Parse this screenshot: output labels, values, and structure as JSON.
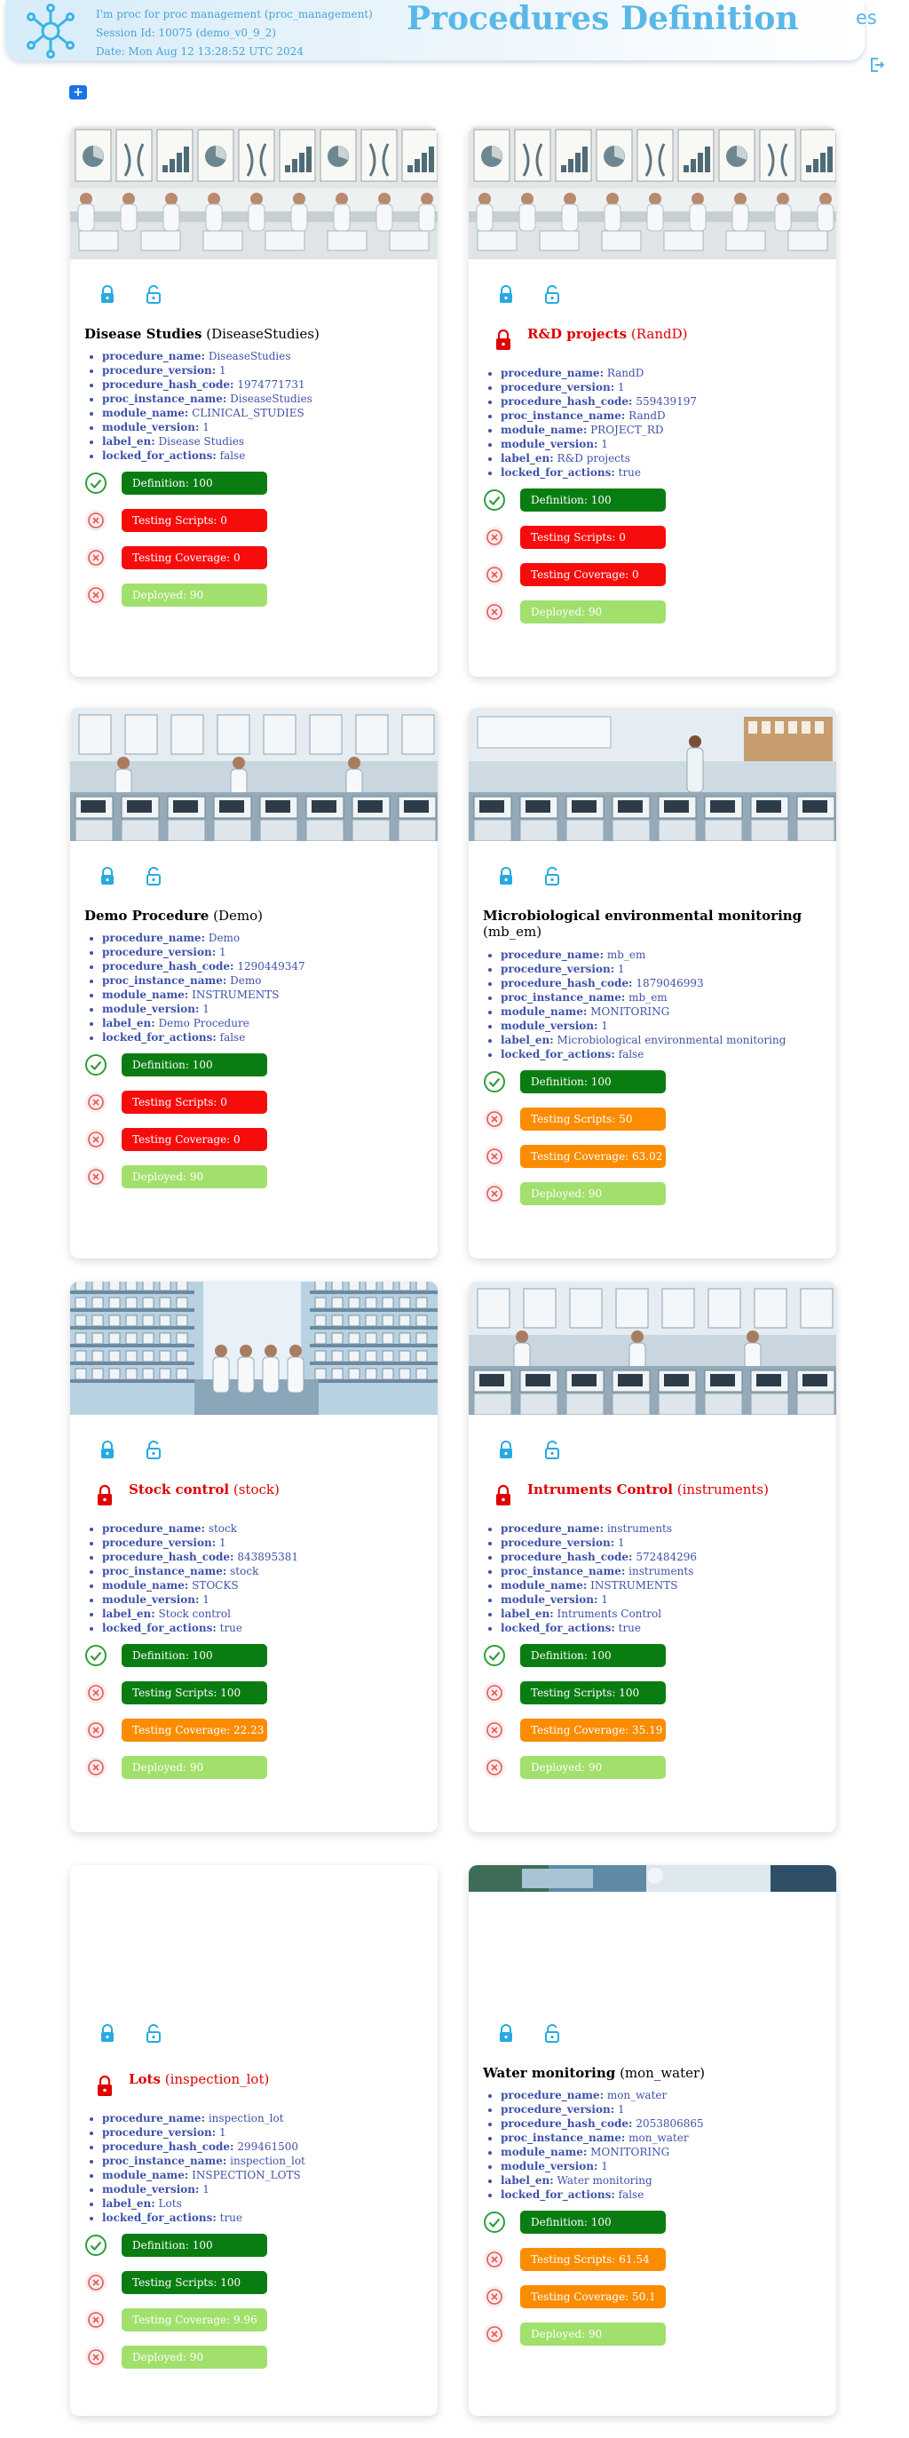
{
  "header": {
    "user_line": "I'm proc for proc management (proc_management)",
    "session_line": "Session Id: 10075 (demo_v0_9_2)",
    "date_line": "Date: Mon Aug 12 13:28:52 UTC 2024",
    "title": "Procedures Definition",
    "language": "es",
    "add_label": "+"
  },
  "colors": {
    "definition": "#0a7d12",
    "fail": "#f70c0c",
    "partial": "#fb8c00",
    "deployed": "#a1e06c",
    "accent": "#5ab8e8"
  },
  "procedures": [
    {
      "name": "Disease Studies",
      "code": "(DiseaseStudies)",
      "props": [
        {
          "k": "procedure_name:",
          "v": "DiseaseStudies"
        },
        {
          "k": "procedure_version:",
          "v": "1"
        },
        {
          "k": "procedure_hash_code:",
          "v": "1974771731"
        },
        {
          "k": "proc_instance_name:",
          "v": "DiseaseStudies"
        },
        {
          "k": "module_name:",
          "v": "CLINICAL_STUDIES"
        },
        {
          "k": "module_version:",
          "v": "1"
        },
        {
          "k": "label_en:",
          "v": "Disease Studies"
        },
        {
          "k": "locked_for_actions:",
          "v": "false"
        }
      ],
      "definition": "Definition: 100",
      "testing_scripts": "Testing Scripts: 0",
      "testing_coverage": "Testing Coverage: 0",
      "deployed": "Deployed: 90"
    },
    {
      "name": "R&D projects",
      "code": "(RandD)",
      "props": [
        {
          "k": "procedure_name:",
          "v": "RandD"
        },
        {
          "k": "procedure_version:",
          "v": "1"
        },
        {
          "k": "procedure_hash_code:",
          "v": "559439197"
        },
        {
          "k": "proc_instance_name:",
          "v": "RandD"
        },
        {
          "k": "module_name:",
          "v": "PROJECT_RD"
        },
        {
          "k": "module_version:",
          "v": "1"
        },
        {
          "k": "label_en:",
          "v": "R&D projects"
        },
        {
          "k": "locked_for_actions:",
          "v": "true"
        }
      ],
      "definition": "Definition: 100",
      "testing_scripts": "Testing Scripts: 0",
      "testing_coverage": "Testing Coverage: 0",
      "deployed": "Deployed: 90"
    },
    {
      "name": "Demo Procedure",
      "code": "(Demo)",
      "props": [
        {
          "k": "procedure_name:",
          "v": "Demo"
        },
        {
          "k": "procedure_version:",
          "v": "1"
        },
        {
          "k": "procedure_hash_code:",
          "v": "1290449347"
        },
        {
          "k": "proc_instance_name:",
          "v": "Demo"
        },
        {
          "k": "module_name:",
          "v": "INSTRUMENTS"
        },
        {
          "k": "module_version:",
          "v": "1"
        },
        {
          "k": "label_en:",
          "v": "Demo Procedure"
        },
        {
          "k": "locked_for_actions:",
          "v": "false"
        }
      ],
      "definition": "Definition: 100",
      "testing_scripts": "Testing Scripts: 0",
      "testing_coverage": "Testing Coverage: 0",
      "deployed": "Deployed: 90"
    },
    {
      "name": "Microbiological environmental monitoring",
      "code": "(mb_em)",
      "props": [
        {
          "k": "procedure_name:",
          "v": "mb_em"
        },
        {
          "k": "procedure_version:",
          "v": "1"
        },
        {
          "k": "procedure_hash_code:",
          "v": "1879046993"
        },
        {
          "k": "proc_instance_name:",
          "v": "mb_em"
        },
        {
          "k": "module_name:",
          "v": "MONITORING"
        },
        {
          "k": "module_version:",
          "v": "1"
        },
        {
          "k": "label_en:",
          "v": "Microbiological environmental monitoring"
        },
        {
          "k": "locked_for_actions:",
          "v": "false"
        }
      ],
      "definition": "Definition: 100",
      "testing_scripts": "Testing Scripts: 50",
      "testing_coverage": "Testing Coverage: 63.02",
      "deployed": "Deployed: 90"
    },
    {
      "name": "Stock control",
      "code": "(stock)",
      "props": [
        {
          "k": "procedure_name:",
          "v": "stock"
        },
        {
          "k": "procedure_version:",
          "v": "1"
        },
        {
          "k": "procedure_hash_code:",
          "v": "843895381"
        },
        {
          "k": "proc_instance_name:",
          "v": "stock"
        },
        {
          "k": "module_name:",
          "v": "STOCKS"
        },
        {
          "k": "module_version:",
          "v": "1"
        },
        {
          "k": "label_en:",
          "v": "Stock control"
        },
        {
          "k": "locked_for_actions:",
          "v": "true"
        }
      ],
      "definition": "Definition: 100",
      "testing_scripts": "Testing Scripts: 100",
      "testing_coverage": "Testing Coverage: 22.23",
      "deployed": "Deployed: 90"
    },
    {
      "name": "Intruments Control",
      "code": "(instruments)",
      "props": [
        {
          "k": "procedure_name:",
          "v": "instruments"
        },
        {
          "k": "procedure_version:",
          "v": "1"
        },
        {
          "k": "procedure_hash_code:",
          "v": "572484296"
        },
        {
          "k": "proc_instance_name:",
          "v": "instruments"
        },
        {
          "k": "module_name:",
          "v": "INSTRUMENTS"
        },
        {
          "k": "module_version:",
          "v": "1"
        },
        {
          "k": "label_en:",
          "v": "Intruments Control"
        },
        {
          "k": "locked_for_actions:",
          "v": "true"
        }
      ],
      "definition": "Definition: 100",
      "testing_scripts": "Testing Scripts: 100",
      "testing_coverage": "Testing Coverage: 35.19",
      "deployed": "Deployed: 90"
    },
    {
      "name": "Lots",
      "code": "(inspection_lot)",
      "props": [
        {
          "k": "procedure_name:",
          "v": "inspection_lot"
        },
        {
          "k": "procedure_version:",
          "v": "1"
        },
        {
          "k": "procedure_hash_code:",
          "v": "299461500"
        },
        {
          "k": "proc_instance_name:",
          "v": "inspection_lot"
        },
        {
          "k": "module_name:",
          "v": "INSPECTION_LOTS"
        },
        {
          "k": "module_version:",
          "v": "1"
        },
        {
          "k": "label_en:",
          "v": "Lots"
        },
        {
          "k": "locked_for_actions:",
          "v": "true"
        }
      ],
      "definition": "Definition: 100",
      "testing_scripts": "Testing Scripts: 100",
      "testing_coverage": "Testing Coverage: 9.96",
      "deployed": "Deployed: 90"
    },
    {
      "name": "Water monitoring",
      "code": "(mon_water)",
      "props": [
        {
          "k": "procedure_name:",
          "v": "mon_water"
        },
        {
          "k": "procedure_version:",
          "v": "1"
        },
        {
          "k": "procedure_hash_code:",
          "v": "2053806865"
        },
        {
          "k": "proc_instance_name:",
          "v": "mon_water"
        },
        {
          "k": "module_name:",
          "v": "MONITORING"
        },
        {
          "k": "module_version:",
          "v": "1"
        },
        {
          "k": "label_en:",
          "v": "Water monitoring"
        },
        {
          "k": "locked_for_actions:",
          "v": "false"
        }
      ],
      "definition": "Definition: 100",
      "testing_scripts": "Testing Scripts: 61.54",
      "testing_coverage": "Testing Coverage: 50.1",
      "deployed": "Deployed: 90"
    }
  ]
}
